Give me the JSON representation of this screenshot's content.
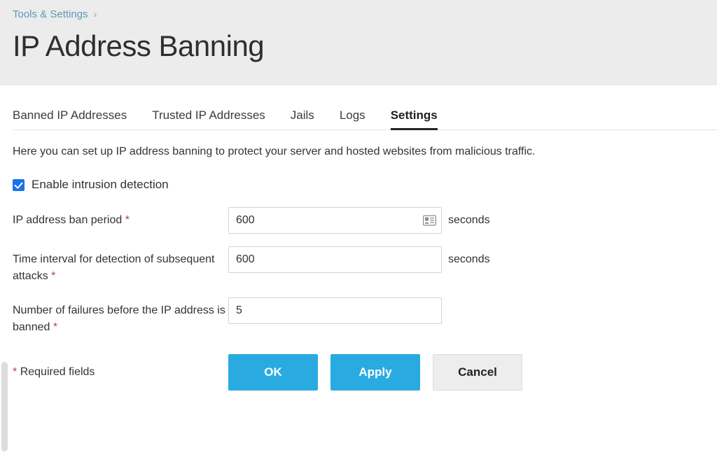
{
  "header": {
    "breadcrumb": {
      "label": "Tools & Settings",
      "separator": "›"
    },
    "title": "IP Address Banning"
  },
  "tabs": [
    {
      "label": "Banned IP Addresses",
      "active": false
    },
    {
      "label": "Trusted IP Addresses",
      "active": false
    },
    {
      "label": "Jails",
      "active": false
    },
    {
      "label": "Logs",
      "active": false
    },
    {
      "label": "Settings",
      "active": true
    }
  ],
  "main": {
    "description": "Here you can set up IP address banning to protect your server and hosted websites from malicious traffic.",
    "enable_checkbox": {
      "label": "Enable intrusion detection",
      "checked": true
    },
    "fields": [
      {
        "label": "IP address ban period",
        "required_marker": "*",
        "value": "600",
        "unit": "seconds",
        "icon": "contact-card-autofill-icon"
      },
      {
        "label": "Time interval for detection of subsequent attacks",
        "required_marker": "*",
        "value": "600",
        "unit": "seconds",
        "icon": ""
      },
      {
        "label": "Number of failures before the IP address is banned",
        "required_marker": "*",
        "value": "5",
        "unit": "",
        "icon": ""
      }
    ],
    "required_note_marker": "*",
    "required_note": "Required fields",
    "buttons": [
      {
        "label": "OK",
        "style": "primary"
      },
      {
        "label": "Apply",
        "style": "primary"
      },
      {
        "label": "Cancel",
        "style": "secondary"
      }
    ]
  },
  "colors": {
    "accent_blue": "#29abe2",
    "checkbox_blue": "#1a73e8",
    "breadcrumb_link": "#5c9ab4",
    "required_red": "#a94464",
    "header_bg": "#ececec",
    "content_bg": "#ffffff"
  }
}
